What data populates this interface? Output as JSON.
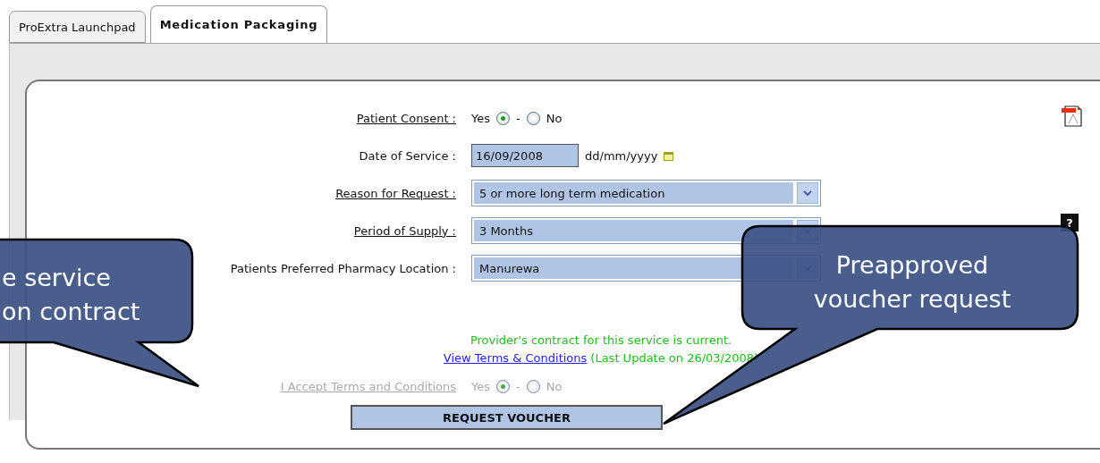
{
  "tabs": [
    {
      "label": "ProExtra Launchpad",
      "selected": false
    },
    {
      "label": "Medication Packaging",
      "selected": true
    }
  ],
  "form": {
    "rows": [
      {
        "kind": "radio",
        "label": "Patient Consent :",
        "underlined": true,
        "separator": "-",
        "options": [
          {
            "label": "Yes",
            "selected": true
          },
          {
            "label": "No",
            "selected": false
          }
        ]
      },
      {
        "kind": "date",
        "label": "Date of Service :",
        "underlined": false,
        "value": "16/09/2008",
        "format": "dd/mm/yyyy"
      },
      {
        "kind": "select",
        "label": "Reason for Request :",
        "underlined": true,
        "value": "5 or more long term medication"
      },
      {
        "kind": "select",
        "label": "Period of Supply :",
        "underlined": true,
        "value": "3 Months",
        "help": "?"
      },
      {
        "kind": "select",
        "label": "Patients Preferred Pharmacy Location :",
        "underlined": false,
        "value": "Manurewa"
      }
    ]
  },
  "contract": {
    "status": "Provider's contract for this service is current.",
    "link": "View Terms & Conditions",
    "last_update": "(Last Update on 26/03/2008)"
  },
  "accept": {
    "label": "I Accept Terms and Conditions",
    "disabled": true,
    "separator": "-",
    "options": [
      {
        "label": "Yes",
        "selected": true
      },
      {
        "label": "No",
        "selected": false
      }
    ]
  },
  "submit": "REQUEST VOUCHER",
  "callouts": [
    {
      "lines": [
        "e service",
        "on contract"
      ]
    },
    {
      "lines": [
        "Preapproved",
        "voucher request"
      ]
    }
  ]
}
